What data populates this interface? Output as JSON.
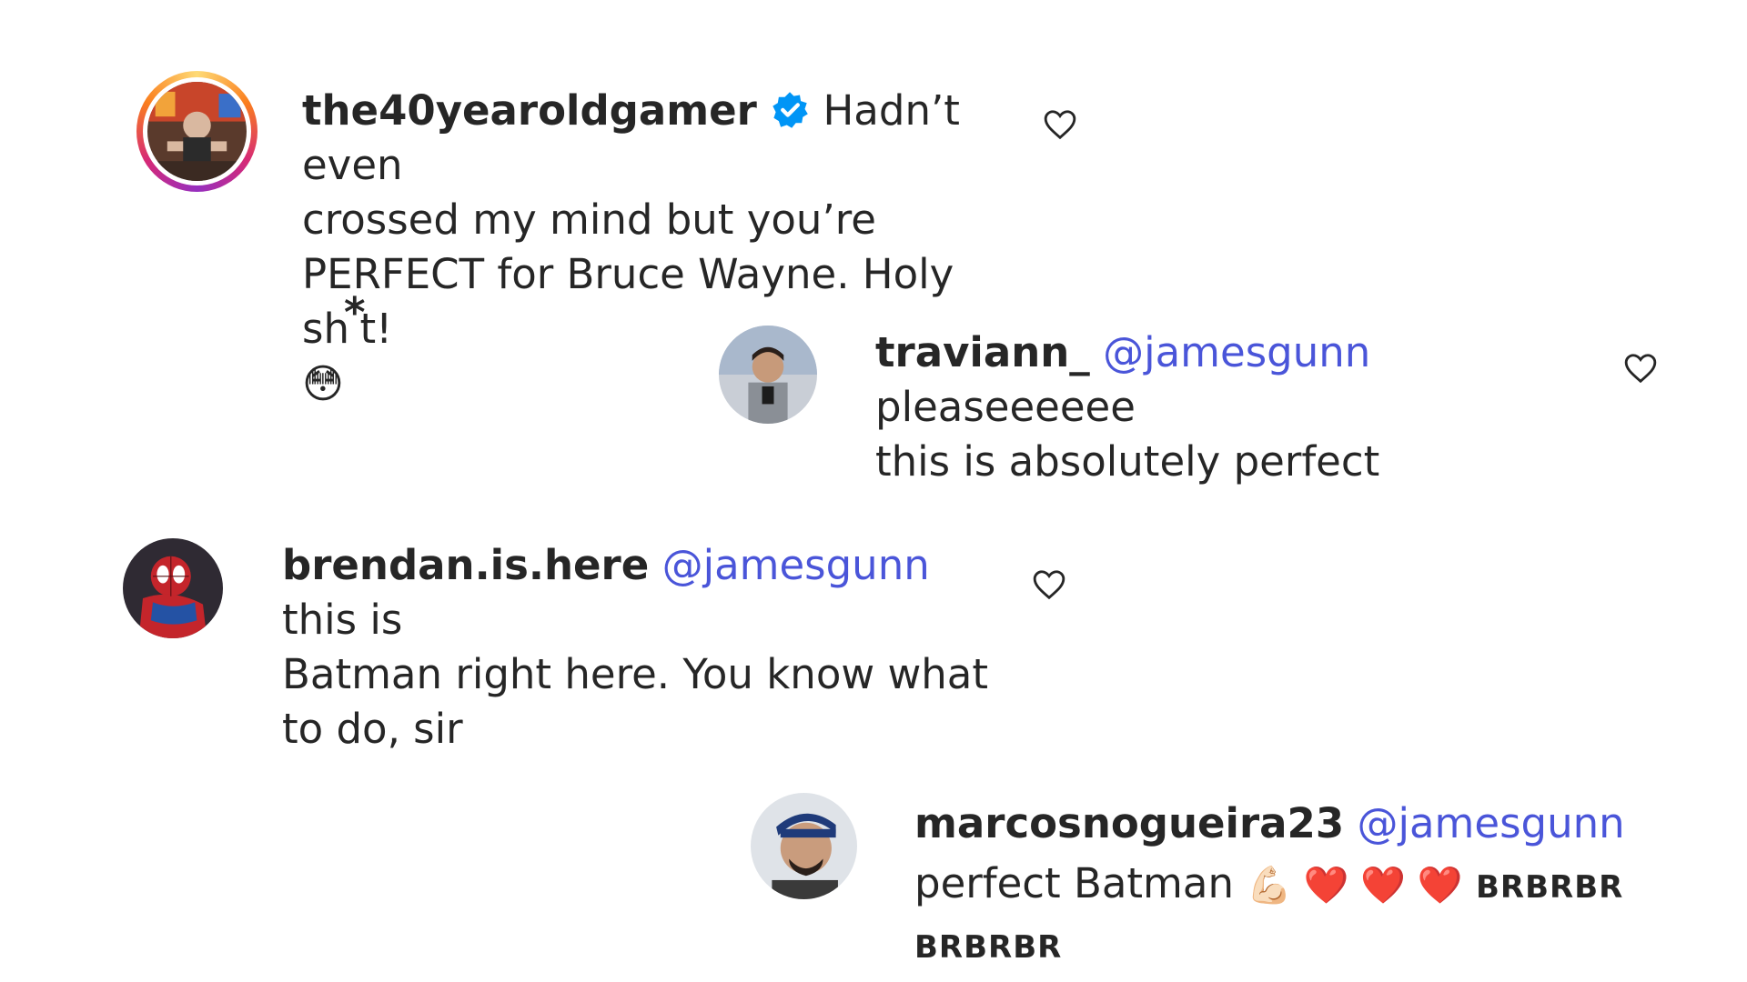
{
  "comments": [
    {
      "username": "the40yearoldgamer",
      "verified": true,
      "text_1": "Hadn’t even",
      "text_2": "crossed my mind but you’re",
      "text_3": "PERFECT for Bruce Wayne. Holy sh",
      "text_3_sticker": "*",
      "text_3_end": "t!",
      "emoji": "😳",
      "avatar_icon": "gamer-avatar-icon"
    },
    {
      "username": "traviann_",
      "mention": "@jamesgunn",
      "text_1": "pleaseeeeee",
      "text_2": "this is absolutely perfect",
      "avatar_icon": "traviann-avatar-icon"
    },
    {
      "username": "brendan.is.here",
      "mention": "@jamesgunn",
      "text_1": "this is",
      "text_2": "Batman right here. You know what",
      "text_3": "to do, sir",
      "avatar_icon": "spiderman-avatar-icon"
    },
    {
      "username": "marcosnogueira23",
      "mention": "@jamesgunn",
      "text_1": "perfect Batman",
      "emojis": "💪🏻 ❤️ ❤️ ❤️",
      "tag_1": "BRBRBR",
      "tag_2": "BRBRBR",
      "avatar_icon": "marcos-avatar-icon"
    }
  ],
  "colors": {
    "mention": "#4a55d9",
    "verified": "#0095f6",
    "text": "#262626"
  }
}
